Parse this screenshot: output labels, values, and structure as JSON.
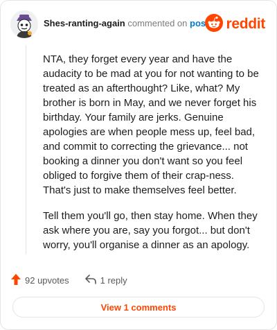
{
  "comment": {
    "username": "Shes-ranting-again",
    "action_text": "commented on",
    "post_link": "post",
    "paragraphs": [
      "NTA, they forget every year and have the audacity to be mad at you for not wanting to be treated as an afterthought? Like, what? My brother is born in May, and we never forget his birthday. Your family are jerks. Genuine apologies are when people mess up, feel bad, and commit to correcting the grievance... not booking a dinner you don't want so you feel obliged to forgive them of their crap-ness. That's just to make themselves feel better.",
      "Tell them you'll go, then stay home. When they ask where you are, say you forgot... but don't worry, you'll organise a dinner as an apology."
    ]
  },
  "brand": {
    "name": "reddit",
    "color": "#ff4500",
    "icon": "reddit-logo-icon"
  },
  "actions": {
    "upvotes": "92 upvotes",
    "replies": "1 reply",
    "upvote_icon": "upvote-arrow-icon",
    "reply_icon": "reply-arrow-icon",
    "upvote_color": "#ff4500"
  },
  "footer": {
    "view_comments_label": "View 1 comments"
  },
  "colors": {
    "link": "#0079d3",
    "muted": "#7c7c7c",
    "accent": "#ff4500"
  }
}
